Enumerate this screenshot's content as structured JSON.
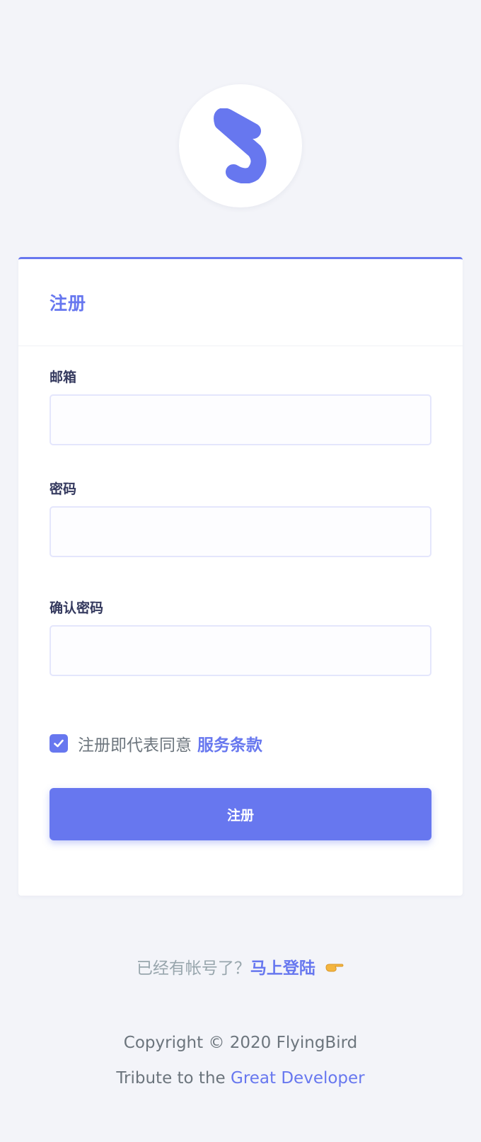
{
  "logo": {
    "icon": "s-logo-icon",
    "color": "#6777ef"
  },
  "register_card": {
    "title": "注册",
    "email": {
      "label": "邮箱",
      "value": "",
      "placeholder": ""
    },
    "password": {
      "label": "密码",
      "value": "",
      "placeholder": ""
    },
    "confirm_password": {
      "label": "确认密码",
      "value": "",
      "placeholder": ""
    },
    "agree": {
      "checked": true,
      "text": "注册即代表同意",
      "terms_link": "服务条款"
    },
    "submit_label": "注册"
  },
  "login_prompt": {
    "text": "已经有帐号了？",
    "link": "马上登陆",
    "icon": "pointing-hand-icon"
  },
  "footer": {
    "copyright": "Copyright © 2020 FlyingBird",
    "tribute_text": "Tribute to the",
    "tribute_link": "Great Developer"
  },
  "colors": {
    "accent": "#6777ef",
    "background": "#f3f4f9"
  }
}
